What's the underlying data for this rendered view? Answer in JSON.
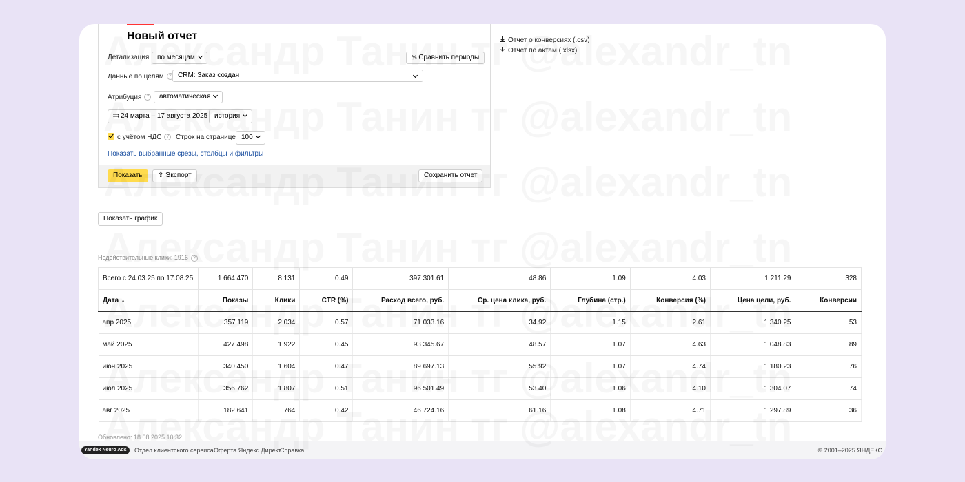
{
  "form": {
    "title": "Новый отчет",
    "detail_label": "Детализация",
    "detail_value": "по месяцам",
    "compare_button": "Сравнить периоды",
    "goals_label": "Данные по целям",
    "goals_value": "CRM: Заказ создан",
    "attribution_label": "Атрибуция",
    "attribution_value": "автоматическая",
    "date_range": "24 марта – 17 августа 2025",
    "history_value": "история",
    "vat_label": "с учётом НДС",
    "rows_label": "Строк на странице",
    "rows_value": "100",
    "show_slices_link": "Показать выбранные срезы, столбцы и фильтры",
    "show_button": "Показать",
    "export_button": "Экспорт",
    "save_button": "Сохранить отчет"
  },
  "downloads": {
    "conversions_csv": "Отчет о конверсиях (.csv)",
    "acts_xlsx": "Отчет по актам (.xlsx)"
  },
  "show_chart_button": "Показать график",
  "invalid_clicks": "Недействительные клики: 1916",
  "table": {
    "total": [
      "Всего с 24.03.25 по 17.08.25",
      "1 664 470",
      "8 131",
      "0.49",
      "397 301.61",
      "48.86",
      "1.09",
      "4.03",
      "1 211.29",
      "328"
    ],
    "headers": [
      "Дата",
      "Показы",
      "Клики",
      "CTR (%)",
      "Расход всего, руб.",
      "Ср. цена клика, руб.",
      "Глубина (стр.)",
      "Конверсия (%)",
      "Цена цели, руб.",
      "Конверсии"
    ],
    "rows": [
      [
        "апр 2025",
        "357 119",
        "2 034",
        "0.57",
        "71 033.16",
        "34.92",
        "1.15",
        "2.61",
        "1 340.25",
        "53"
      ],
      [
        "май 2025",
        "427 498",
        "1 922",
        "0.45",
        "93 345.67",
        "48.57",
        "1.07",
        "4.63",
        "1 048.83",
        "89"
      ],
      [
        "июн 2025",
        "340 450",
        "1 604",
        "0.47",
        "89 697.13",
        "55.92",
        "1.07",
        "4.74",
        "1 180.23",
        "76"
      ],
      [
        "июл 2025",
        "356 762",
        "1 807",
        "0.51",
        "96 501.49",
        "53.40",
        "1.06",
        "4.10",
        "1 304.07",
        "74"
      ],
      [
        "авг 2025",
        "182 641",
        "764",
        "0.42",
        "46 724.16",
        "61.16",
        "1.08",
        "4.71",
        "1 297.89",
        "36"
      ]
    ]
  },
  "updated": "Обновлено: 18.08.2025 10:32",
  "footer": {
    "badge": "Yandex Neuro Ads",
    "link1": "Отдел клиентского сервиса",
    "link2": "Оферта Яндекс Директ",
    "link3": "Справка",
    "copyright": "© 2001–2025 ЯНДЕКС"
  },
  "watermark": "Александр Танин тг @alexandr_tn"
}
